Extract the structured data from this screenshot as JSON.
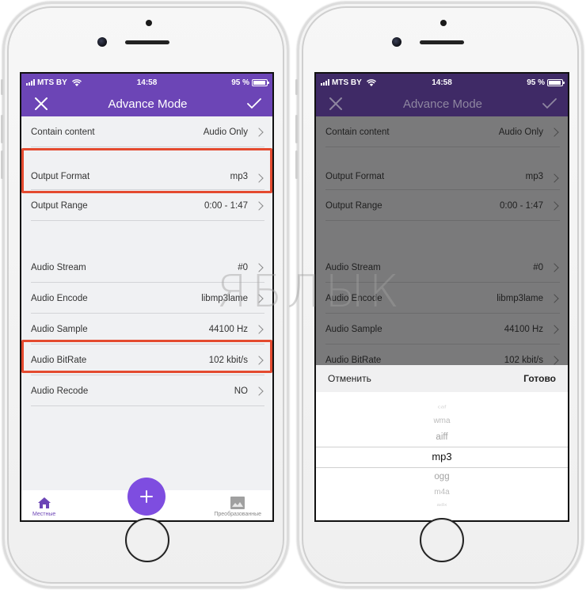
{
  "status_bar": {
    "carrier": "MTS BY",
    "time": "14:58",
    "battery": "95 %",
    "battery_level_percent": 95
  },
  "nav": {
    "title": "Advance Mode",
    "close_icon": "close-icon",
    "confirm_icon": "checkmark-icon"
  },
  "settings": [
    {
      "label": "Contain content",
      "value": "Audio Only"
    },
    {
      "label": "Output Format",
      "value": "mp3"
    },
    {
      "label": "Output Range",
      "value": "0:00 - 1:47"
    },
    {
      "label": "Audio Stream",
      "value": "#0"
    },
    {
      "label": "Audio Encode",
      "value": "libmp3lame"
    },
    {
      "label": "Audio Sample",
      "value": "44100 Hz"
    },
    {
      "label": "Audio BitRate",
      "value": "102 kbit/s"
    },
    {
      "label": "Audio Recode",
      "value": "NO"
    }
  ],
  "highlighted_rows": [
    "Output Format",
    "Audio BitRate"
  ],
  "highlight_color": "#e44a2f",
  "tabbar": {
    "local_label": "Местные",
    "converted_label": "Преобразованные",
    "add_icon": "plus-icon"
  },
  "picker_sheet": {
    "cancel_label": "Отменить",
    "done_label": "Готово",
    "options": [
      "caf",
      "wma",
      "aiff",
      "mp3",
      "ogg",
      "m4a",
      "adx"
    ],
    "selected": "mp3"
  },
  "watermark": "ЯБЛЫК",
  "colors": {
    "accent": "#6c45b6",
    "fab": "#7e4de0",
    "accent_dimmed": "#3f2a66"
  }
}
